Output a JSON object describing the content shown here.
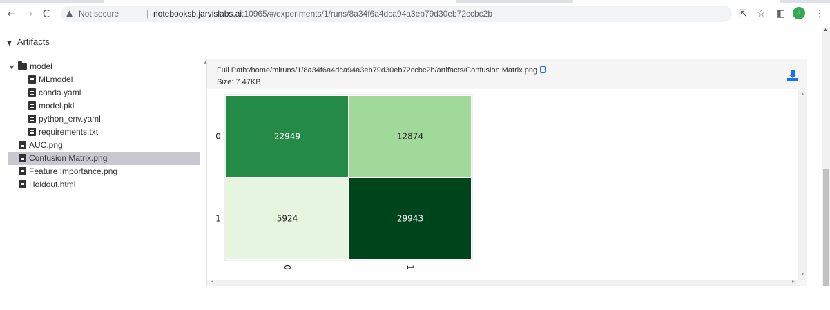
{
  "browser": {
    "nav": {
      "back": "←",
      "forward": "→",
      "reload": "C"
    },
    "security_label": "Not secure",
    "url_host": "notebooksb.jarvislabs.ai",
    "url_path": ":10965/#/experiments/1/runs/8a34f6a4dca94a3eb79d30eb72ccbc2b",
    "profile_initial": "J"
  },
  "section": {
    "title": "Artifacts"
  },
  "tree": {
    "folder": {
      "label": "model"
    },
    "children": [
      {
        "label": "MLmodel"
      },
      {
        "label": "conda.yaml"
      },
      {
        "label": "model.pkl"
      },
      {
        "label": "python_env.yaml"
      },
      {
        "label": "requirements.txt"
      }
    ],
    "files": [
      {
        "label": "AUC.png"
      },
      {
        "label": "Confusion Matrix.png",
        "selected": true
      },
      {
        "label": "Feature Importance.png"
      },
      {
        "label": "Holdout.html"
      }
    ]
  },
  "preview": {
    "full_path": "Full Path:/home/mlruns/1/8a34f6a4dca94a3eb79d30eb72ccbc2b/artifacts/Confusion Matrix.png",
    "size": "Size: 7.47KB"
  },
  "chart_data": {
    "type": "heatmap",
    "title": "",
    "xlabel": "",
    "ylabel": "",
    "x_categories": [
      "0",
      "1"
    ],
    "y_categories": [
      "0",
      "1"
    ],
    "values": [
      [
        22949,
        12874
      ],
      [
        5924,
        29943
      ]
    ],
    "colormap": "Greens",
    "colors": [
      [
        "#238b45",
        "#a1d99b"
      ],
      [
        "#e5f5e0",
        "#00441b"
      ]
    ],
    "label_colors": [
      [
        "#ffffff",
        "#262626"
      ],
      [
        "#262626",
        "#ffffff"
      ]
    ]
  }
}
